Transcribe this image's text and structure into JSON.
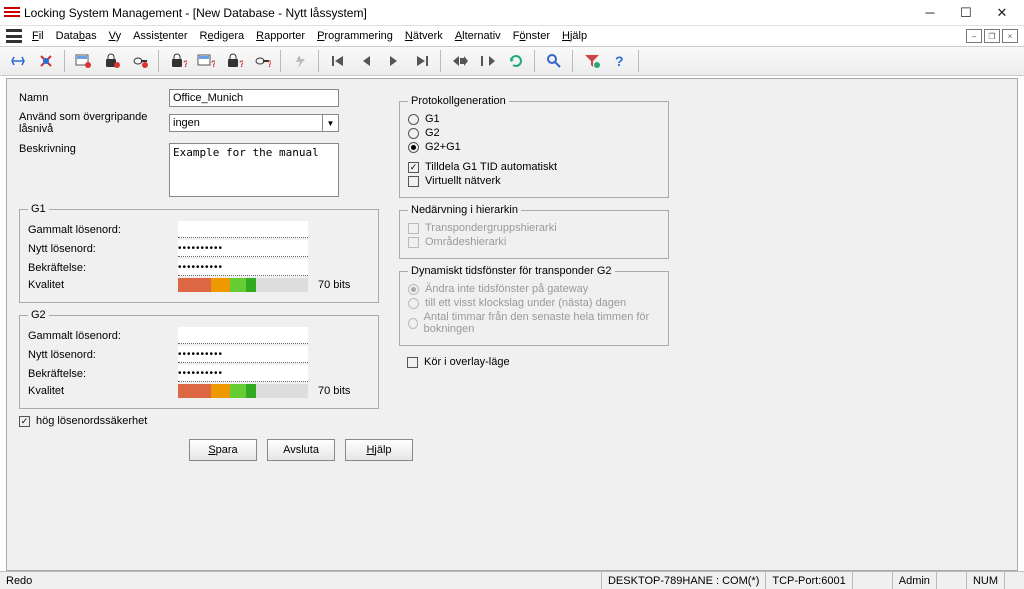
{
  "window": {
    "title": "Locking System Management - [New Database - Nytt låssystem]"
  },
  "menu": {
    "fil": "Fil",
    "databas": "Databas",
    "vy": "Vy",
    "assistenter": "Assistenter",
    "redigera": "Redigera",
    "rapporter": "Rapporter",
    "programmering": "Programmering",
    "natverk": "Nätverk",
    "alternativ": "Alternativ",
    "fonster": "Fönster",
    "hjalp": "Hjälp"
  },
  "form": {
    "namn_label": "Namn",
    "namn_value": "Office_Munich",
    "niva_label": "Använd som övergripande låsnivå",
    "niva_value": "ingen",
    "beskrivning_label": "Beskrivning",
    "beskrivning_value": "Example for the manual",
    "g1_legend": "G1",
    "g2_legend": "G2",
    "gammalt": "Gammalt lösenord:",
    "nytt": "Nytt lösenord:",
    "bekraft": "Bekräftelse:",
    "kvalitet": "Kvalitet",
    "bits": "70 bits",
    "hogsak": "hög lösenordssäkerhet",
    "spara": "Spara",
    "avsluta": "Avsluta",
    "hjalp": "Hjälp"
  },
  "right": {
    "proto_legend": "Protokollgeneration",
    "g1": "G1",
    "g2": "G2",
    "g2g1": "G2+G1",
    "tilldela": "Tilldela G1 TID automatiskt",
    "virtuellt": "Virtuellt nätverk",
    "ned_legend": "Nedärvning i hierarkin",
    "tgh": "Transpondergruppshierarki",
    "oh": "Områdeshierarki",
    "dyn_legend": "Dynamiskt tidsfönster för transponder G2",
    "dyn1": "Ändra inte tidsfönster på gateway",
    "dyn2": "till ett visst klockslag under (nästa) dagen",
    "dyn3": "Antal timmar från den senaste hela timmen för bokningen",
    "overlay": "Kör i overlay-läge"
  },
  "status": {
    "redo": "Redo",
    "host": "DESKTOP-789HANE : COM(*)",
    "port": "TCP-Port:6001",
    "admin": "Admin",
    "num": "NUM"
  }
}
